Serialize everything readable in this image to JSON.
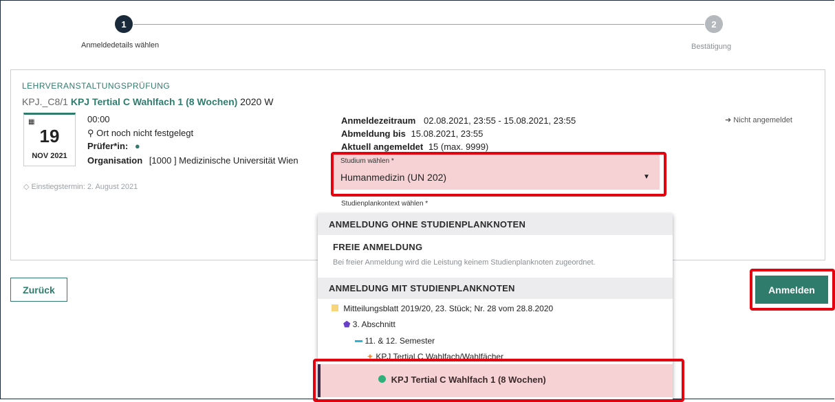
{
  "stepper": {
    "step1_number": "1",
    "step1_label": "Anmeldedetails wählen",
    "step2_number": "2",
    "step2_label": "Bestätigung",
    "active_color": "#1b2a3a",
    "inactive_color": "#b5b8bc"
  },
  "course": {
    "type": "LEHRVERANSTALTUNGSPRÜFUNG",
    "code": "KPJ._C8/1",
    "title": "KPJ Tertial C Wahlfach 1 (8 Wochen)",
    "semester": "2020 W",
    "date_day": "19",
    "date_month_year": "NOV 2021",
    "time": "00:00",
    "location": "Ort noch nicht festgelegt",
    "examiner_label": "Prüfer*in:",
    "organisation_label": "Organisation",
    "organisation_value": "[1000 ] Medizinische Universität Wien",
    "entry_date": "Einstiegstermin: 2. August 2021",
    "reg_period_label": "Anmeldezeitraum",
    "reg_period_value": "02.08.2021, 23:55 - 15.08.2021, 23:55",
    "dereg_label": "Abmeldung bis",
    "dereg_value": "15.08.2021, 23:55",
    "current_label": "Aktuell angemeldet",
    "current_value": "15 (max. 9999)",
    "status": "Nicht angemeldet"
  },
  "form": {
    "studium_label": "Studium wählen *",
    "studium_value": "Humanmedizin (UN 202)",
    "kontext_label": "Studienplankontext wählen *"
  },
  "dropdown": {
    "group1_header": "ANMELDUNG OHNE STUDIENPLANKNOTEN",
    "free_title": "FREIE ANMELDUNG",
    "free_desc": "Bei freier Anmeldung wird die Leistung keinem Studienplanknoten zugeordnet.",
    "group2_header": "ANMELDUNG MIT STUDIENPLANKNOTEN",
    "tree": [
      "Mitteilungsblatt 2019/20, 23. Stück; Nr. 28 vom 28.8.2020",
      "3. Abschnitt",
      "11. & 12. Semester",
      "KPJ Tertial C Wahlfach/Wahlfächer"
    ],
    "selected": "KPJ Tertial C Wahlfach 1 (8 Wochen)"
  },
  "buttons": {
    "back": "Zurück",
    "register": "Anmelden"
  },
  "colors": {
    "teal": "#2f7c6d",
    "highlight_red": "#e3000f",
    "selection_bg": "#f6d2d4"
  }
}
